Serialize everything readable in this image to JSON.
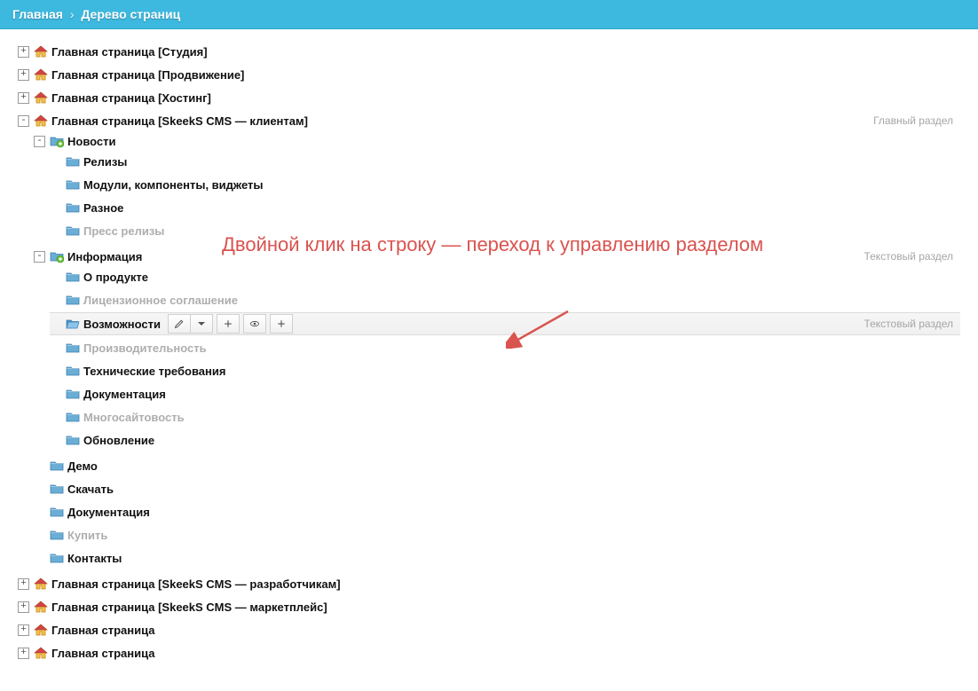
{
  "breadcrumb": {
    "home": "Главная",
    "current": "Дерево страниц"
  },
  "side": {
    "main_section": "Главный раздел",
    "text_section": "Текстовый раздел"
  },
  "annotation_text": "Двойной клик на строку — переход к управлению разделом",
  "tree": [
    {
      "icon": "home",
      "label": "Главная страница [Студия]",
      "toggle": "plus"
    },
    {
      "icon": "home",
      "label": "Главная страница [Продвижение]",
      "toggle": "plus"
    },
    {
      "icon": "home",
      "label": "Главная страница [Хостинг]",
      "toggle": "plus"
    },
    {
      "icon": "home",
      "label": "Главная страница [SkeekS CMS — клиентам]",
      "toggle": "minus",
      "side": "main_section",
      "children": [
        {
          "icon": "feed",
          "label": "Новости",
          "toggle": "minus",
          "children": [
            {
              "icon": "folder",
              "label": "Релизы"
            },
            {
              "icon": "folder",
              "label": "Модули, компоненты, виджеты"
            },
            {
              "icon": "folder",
              "label": "Разное"
            },
            {
              "icon": "folder",
              "label": "Пресс релизы",
              "dim": true
            }
          ]
        },
        {
          "icon": "feed",
          "label": "Информация",
          "toggle": "minus",
          "side": "text_section",
          "children": [
            {
              "icon": "folder",
              "label": "О продукте"
            },
            {
              "icon": "folder",
              "label": "Лицензионное соглашение",
              "dim": true
            },
            {
              "icon": "folder-open",
              "label": "Возможности",
              "highlighted": true,
              "side": "text_section"
            },
            {
              "icon": "folder",
              "label": "Производительность",
              "dim": true
            },
            {
              "icon": "folder",
              "label": "Технические требования"
            },
            {
              "icon": "folder",
              "label": "Документация"
            },
            {
              "icon": "folder",
              "label": "Многосайтовость",
              "dim": true
            },
            {
              "icon": "folder",
              "label": "Обновление"
            }
          ]
        },
        {
          "icon": "folder",
          "label": "Демо"
        },
        {
          "icon": "folder",
          "label": "Скачать"
        },
        {
          "icon": "folder",
          "label": "Документация"
        },
        {
          "icon": "folder",
          "label": "Купить",
          "dim": true
        },
        {
          "icon": "folder",
          "label": "Контакты"
        }
      ]
    },
    {
      "icon": "home",
      "label": "Главная страница [SkeekS CMS — разработчикам]",
      "toggle": "plus"
    },
    {
      "icon": "home",
      "label": "Главная страница [SkeekS CMS — маркетплейс]",
      "toggle": "plus"
    },
    {
      "icon": "home",
      "label": "Главная страница",
      "toggle": "plus"
    },
    {
      "icon": "home",
      "label": "Главная страница",
      "toggle": "plus"
    }
  ]
}
